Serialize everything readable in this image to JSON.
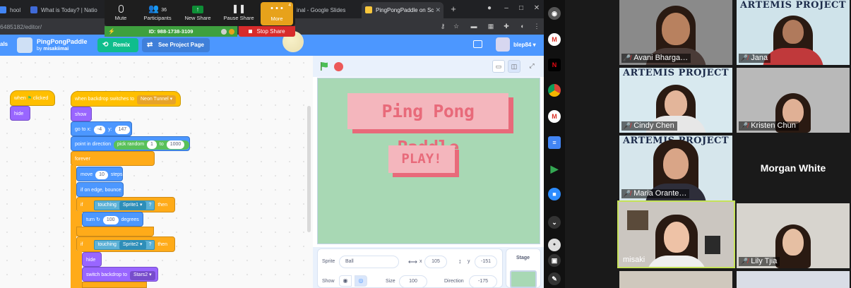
{
  "browser": {
    "tabs": [
      {
        "label": "hool",
        "icon_color": "#4285f4"
      },
      {
        "label": "What is Today? | Natio",
        "icon_color": "#3f6ad8"
      },
      {
        "label": "inal - Google Slides",
        "icon_color": "#f4b400"
      },
      {
        "label": "PingPongPaddle on Sc",
        "icon_color": "#f9c73c",
        "active": true
      }
    ],
    "url": "6485182/editor/"
  },
  "zoom": {
    "mute_label": "Mute",
    "participants_label": "Participants",
    "participants_count": "36",
    "new_share_label": "New Share",
    "pause_share_label": "Pause Share",
    "more_label": "More",
    "more_count": "4",
    "meeting_id": "ID: 988-1738-3109",
    "stop_share_label": "Stop Share"
  },
  "scratch": {
    "menu_left": "als",
    "project_title": "PingPongPaddle",
    "by_prefix": "by",
    "author": "misakiimai",
    "remix_label": "Remix",
    "see_project_label": "See Project Page",
    "username": "blep84",
    "blocks": {
      "when": "when",
      "clicked": "clicked",
      "hide": "hide",
      "when_backdrop": "when backdrop switches to",
      "backdrop_name": "Neon Tunnel",
      "show": "show",
      "go_to_x": "go to x:",
      "x_val": "-4",
      "y_label": "y:",
      "y_val": "147",
      "point_in_direction": "point in direction",
      "pick_random": "pick random",
      "rand_from": "1",
      "rand_to_label": "to",
      "rand_to": "1000",
      "forever": "forever",
      "move": "move",
      "move_steps": "10",
      "steps_label": "steps",
      "if_on_edge": "if on edge, bounce",
      "if_label": "if",
      "touching": "touching",
      "sprite1": "Sprite1",
      "q": "?",
      "then": "then",
      "turn": "turn",
      "turn_deg": "100",
      "degrees_label": "degrees",
      "sprite2": "Sprite2",
      "hide2": "hide",
      "switch_backdrop": "switch backdrop to",
      "backdrop2": "Stars2"
    },
    "stage": {
      "title": "Ping Pong Paddle",
      "play": "PLAY!",
      "background": "#a8d8b4",
      "accent": "#e86a7a"
    },
    "sprite_info": {
      "sprite_label": "Sprite",
      "sprite_name": "Ball",
      "x_label": "x",
      "x_value": "105",
      "y_label": "y",
      "y_value": "-151",
      "show_label": "Show",
      "size_label": "Size",
      "size_value": "100",
      "direction_label": "Direction",
      "direction_value": "-175",
      "stage_label": "Stage"
    }
  },
  "participants": [
    {
      "name": "Avani Bharga…",
      "muted": true
    },
    {
      "name": "Jana",
      "muted": true,
      "artemis": true
    },
    {
      "name": "Cindy Chen",
      "muted": true,
      "artemis": true
    },
    {
      "name": "Kristen Chun",
      "muted": true
    },
    {
      "name": "Maria Orante…",
      "muted": true,
      "artemis": true
    },
    {
      "name": "Morgan White",
      "video_off": true
    },
    {
      "name": "misaki",
      "muted": false,
      "active_speaker": true
    },
    {
      "name": "Lily Tjia",
      "muted": true
    }
  ],
  "artemis_text": "ARTEMIS PROJECT"
}
